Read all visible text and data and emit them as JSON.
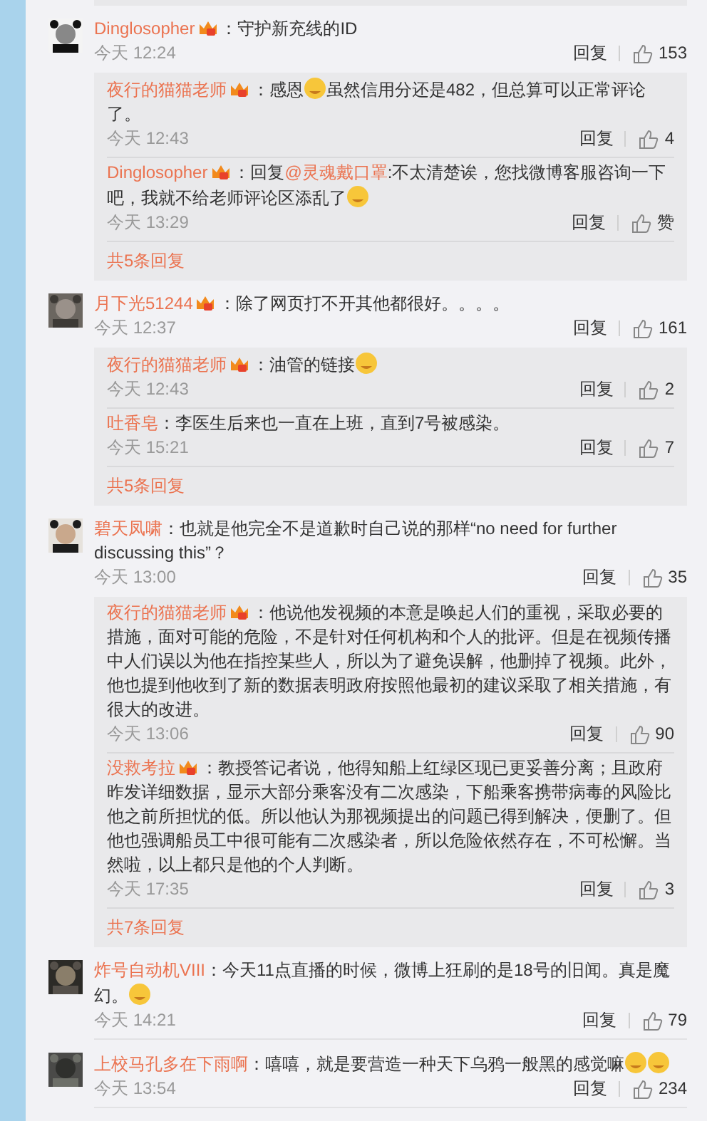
{
  "comments": [
    {
      "avatar": {
        "kind": "picture"
      },
      "user": "Dinglosopher",
      "vip": true,
      "content": [
        {
          "kind": "text",
          "text": "：守护新充线的ID"
        }
      ],
      "time": "今天 12:24",
      "reply_label": "回复",
      "likes": "153",
      "replies": [
        {
          "user": "夜行的猫猫老师",
          "vip": true,
          "content": [
            {
              "kind": "text",
              "text": "：感恩"
            },
            {
              "kind": "emoji"
            },
            {
              "kind": "text",
              "text": "虽然信用分还是482，但总算可以正常评论了。"
            }
          ],
          "time": "今天 12:43",
          "reply_label": "回复",
          "likes": "4"
        },
        {
          "user": "Dinglosopher",
          "vip": true,
          "content": [
            {
              "kind": "text",
              "text": "：回复"
            },
            {
              "kind": "mention",
              "text": "@灵魂戴口罩"
            },
            {
              "kind": "text",
              "text": ":不太清楚诶，您找微博客服咨询一下吧，我就不给老师评论区添乱了"
            },
            {
              "kind": "emoji"
            }
          ],
          "time": "今天 13:29",
          "reply_label": "回复",
          "likes": "赞"
        }
      ],
      "more": "共5条回复"
    },
    {
      "avatar": {
        "kind": "picture"
      },
      "user": "月下光51244",
      "vip": true,
      "content": [
        {
          "kind": "text",
          "text": "：除了网页打不开其他都很好。。。。"
        }
      ],
      "time": "今天 12:37",
      "reply_label": "回复",
      "likes": "161",
      "replies": [
        {
          "user": "夜行的猫猫老师",
          "vip": true,
          "content": [
            {
              "kind": "text",
              "text": "：油管的链接"
            },
            {
              "kind": "emoji"
            }
          ],
          "time": "今天 12:43",
          "reply_label": "回复",
          "likes": "2"
        },
        {
          "user": "吐香皂",
          "vip": false,
          "content": [
            {
              "kind": "text",
              "text": "：李医生后来也一直在上班，直到7号被感染。"
            }
          ],
          "time": "今天 15:21",
          "reply_label": "回复",
          "likes": "7"
        }
      ],
      "more": "共5条回复"
    },
    {
      "avatar": {
        "kind": "picture"
      },
      "user": "碧天凤啸",
      "vip": false,
      "content": [
        {
          "kind": "text",
          "text": "：也就是他完全不是道歉时自己说的那样“no need for further discussing this”？"
        }
      ],
      "time": "今天 13:00",
      "reply_label": "回复",
      "likes": "35",
      "replies": [
        {
          "user": "夜行的猫猫老师",
          "vip": true,
          "content": [
            {
              "kind": "text",
              "text": "：他说他发视频的本意是唤起人们的重视，采取必要的措施，面对可能的危险，不是针对任何机构和个人的批评。但是在视频传播中人们误以为他在指控某些人，所以为了避免误解，他删掉了视频。此外，他也提到他收到了新的数据表明政府按照他最初的建议采取了相关措施，有很大的改进。"
            }
          ],
          "time": "今天 13:06",
          "reply_label": "回复",
          "likes": "90"
        },
        {
          "user": "没救考拉",
          "vip": true,
          "content": [
            {
              "kind": "text",
              "text": "：教授答记者说，他得知船上红绿区现已更妥善分离；且政府昨发详细数据，显示大部分乘客没有二次感染，下船乘客携带病毒的风险比他之前所担忧的低。所以他认为那视频提出的问题已得到解决，便删了。但他也强调船员工中很可能有二次感染者，所以危险依然存在，不可松懈。当然啦，以上都只是他的个人判断。"
            }
          ],
          "time": "今天 17:35",
          "reply_label": "回复",
          "likes": "3"
        }
      ],
      "more": "共7条回复"
    },
    {
      "avatar": {
        "kind": "picture"
      },
      "user": "炸号自动机VIII",
      "vip": false,
      "content": [
        {
          "kind": "text",
          "text": "：今天11点直播的时候，微博上狂刷的是18号的旧闻。真是魔幻。"
        },
        {
          "kind": "emoji"
        }
      ],
      "time": "今天 14:21",
      "reply_label": "回复",
      "likes": "79"
    },
    {
      "avatar": {
        "kind": "picture"
      },
      "user": "上校马孔多在下雨啊",
      "vip": false,
      "content": [
        {
          "kind": "text",
          "text": "：嘻嘻，就是要营造一种天下乌鸦一般黑的感觉嘛"
        },
        {
          "kind": "emoji"
        },
        {
          "kind": "emoji"
        }
      ],
      "time": "今天 13:54",
      "reply_label": "回复",
      "likes": "234"
    }
  ]
}
